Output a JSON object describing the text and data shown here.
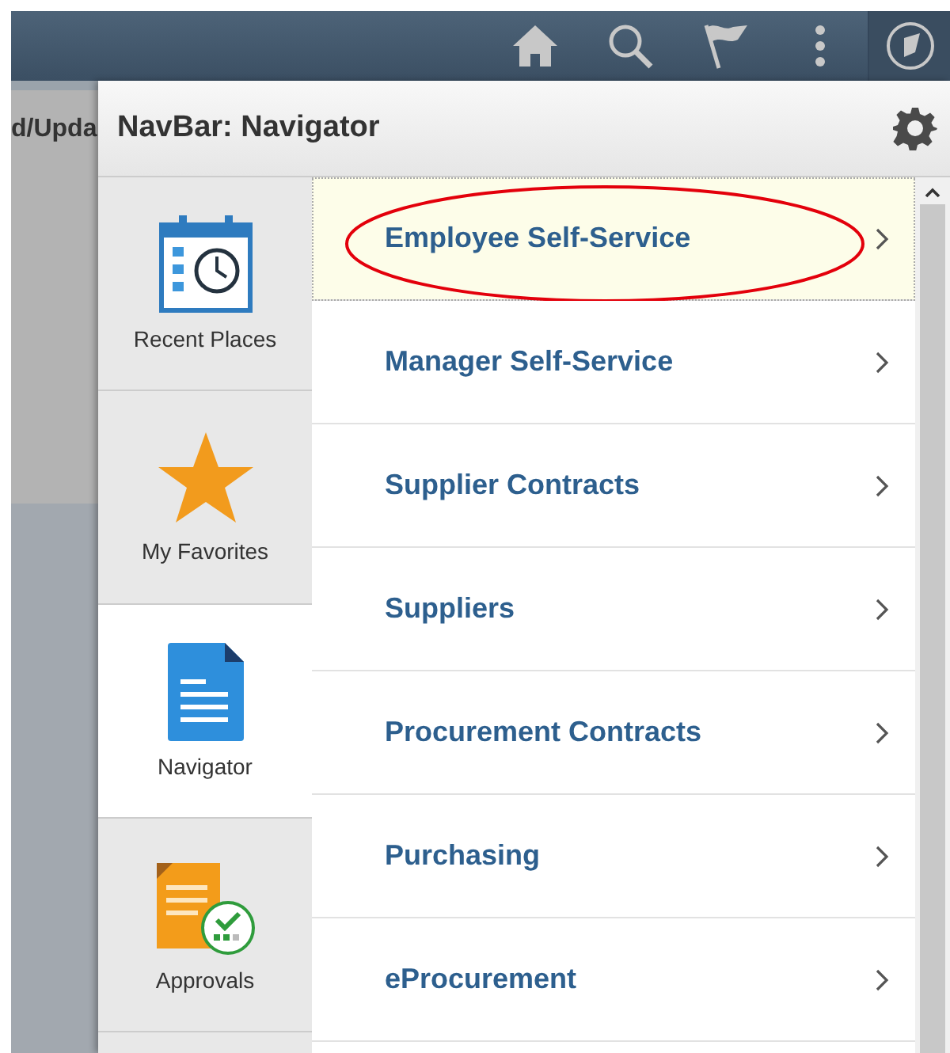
{
  "background_page": {
    "title_fragment": "d/Upda"
  },
  "navigator": {
    "title": "NavBar: Navigator",
    "tabs": [
      {
        "label": "Recent Places",
        "kind": "calendar",
        "selected": false
      },
      {
        "label": "My Favorites",
        "kind": "star",
        "selected": false
      },
      {
        "label": "Navigator",
        "kind": "document",
        "selected": true
      },
      {
        "label": "Approvals",
        "kind": "approval",
        "selected": false
      }
    ],
    "items": [
      {
        "label": "Employee Self-Service",
        "selected": true,
        "circled": true
      },
      {
        "label": "Manager Self-Service",
        "selected": false,
        "circled": false
      },
      {
        "label": "Supplier Contracts",
        "selected": false,
        "circled": false
      },
      {
        "label": "Suppliers",
        "selected": false,
        "circled": false
      },
      {
        "label": "Procurement Contracts",
        "selected": false,
        "circled": false
      },
      {
        "label": "Purchasing",
        "selected": false,
        "circled": false
      },
      {
        "label": "eProcurement",
        "selected": false,
        "circled": false
      }
    ]
  }
}
